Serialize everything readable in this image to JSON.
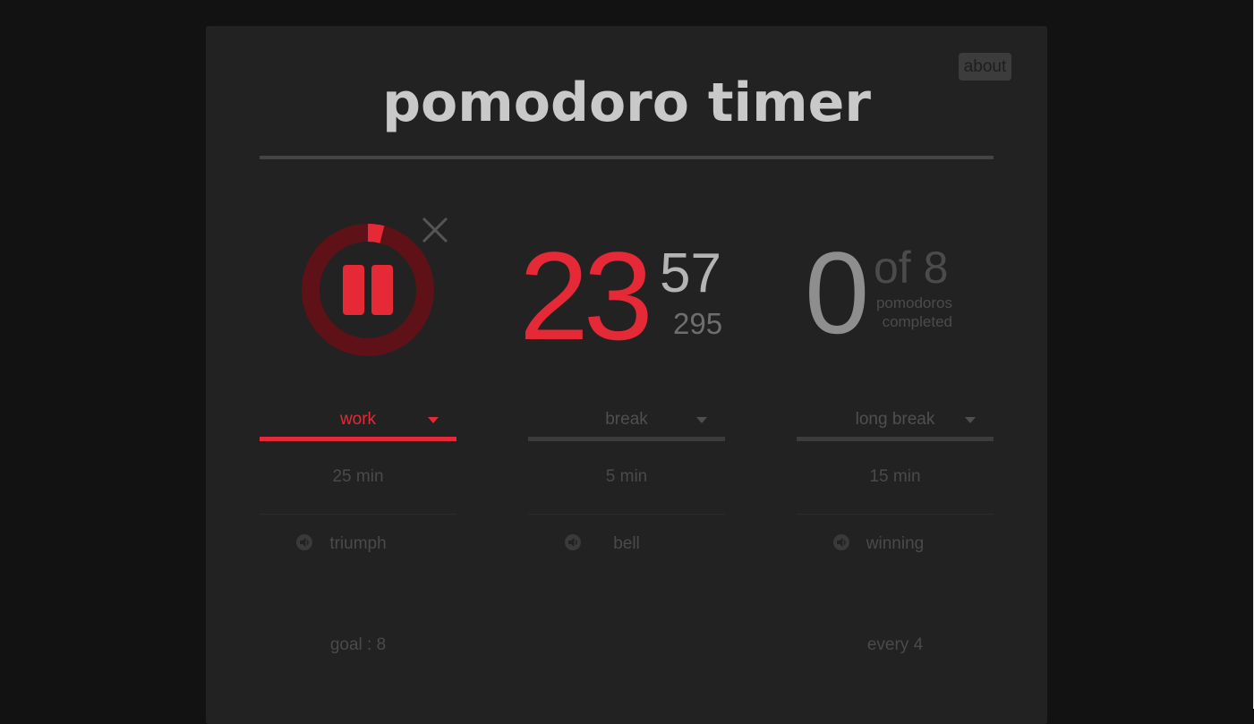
{
  "header": {
    "title": "pomodoro timer",
    "about_label": "about"
  },
  "timer": {
    "minutes": "23",
    "seconds": "57",
    "milliseconds": "295",
    "progress_fraction": 0.04,
    "state": "running"
  },
  "counter": {
    "completed": "0",
    "of_total": "of 8",
    "label_line1": "pomodoros",
    "label_line2": "completed"
  },
  "columns": [
    {
      "mode": "work",
      "duration": "25 min",
      "sound": "triumph",
      "extra": "goal : 8",
      "active": true
    },
    {
      "mode": "break",
      "duration": "5 min",
      "sound": "bell",
      "extra": "",
      "active": false
    },
    {
      "mode": "long break",
      "duration": "15 min",
      "sound": "winning",
      "extra": "every 4",
      "active": false
    }
  ],
  "colors": {
    "accent": "#e62937",
    "accent_dark": "#5e1218",
    "background": "#121212",
    "card": "#222222",
    "muted_text": "#4a4a4a"
  },
  "icons": {
    "play_pause": "pause-icon",
    "close": "close-icon",
    "sound": "speaker-icon",
    "dropdown": "chevron-down-icon"
  }
}
